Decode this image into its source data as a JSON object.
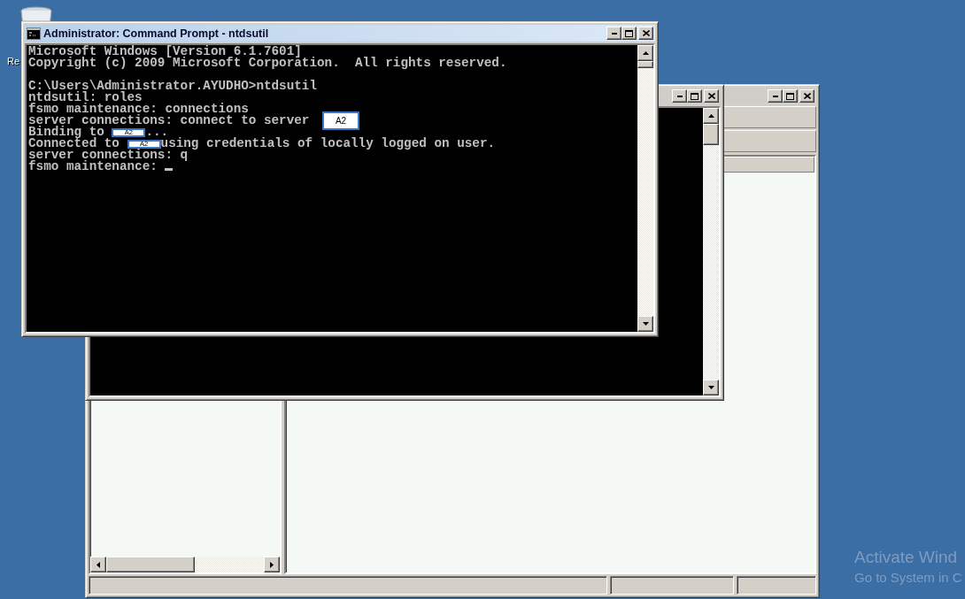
{
  "desktop": {
    "icons": [
      {
        "label": "Re"
      }
    ],
    "activation_notice": {
      "title": "Activate Wind",
      "subtitle": "Go to System in C"
    }
  },
  "windows": [
    {
      "kind": "mmc",
      "active": false
    },
    {
      "kind": "console",
      "active": false
    },
    {
      "kind": "console",
      "active": true,
      "title": "Administrator: Command Prompt - ntdsutil",
      "lines": [
        {
          "blank_before": false,
          "segments": [
            {
              "kind": "text",
              "text": "Microsoft Windows [Version 6.1.7601]"
            }
          ]
        },
        {
          "blank_before": false,
          "segments": [
            {
              "kind": "text",
              "text": "Copyright (c) 2009 Microsoft Corporation.  All rights reserved."
            }
          ]
        },
        {
          "blank_before": true,
          "segments": [
            {
              "kind": "text",
              "text": "C:\\Users\\Administrator.AYUDHO>ntdsutil"
            }
          ]
        },
        {
          "blank_before": false,
          "segments": [
            {
              "kind": "text",
              "text": "ntdsutil: roles"
            }
          ]
        },
        {
          "blank_before": false,
          "segments": [
            {
              "kind": "text",
              "text": "fsmo maintenance: connections"
            }
          ]
        },
        {
          "blank_before": false,
          "segments": [
            {
              "kind": "text",
              "text": "server connections: connect to server "
            },
            {
              "kind": "redaction-large",
              "text": "A2"
            }
          ]
        },
        {
          "blank_before": false,
          "segments": [
            {
              "kind": "text",
              "text": "Binding to "
            },
            {
              "kind": "redaction",
              "text": "A2"
            },
            {
              "kind": "text",
              "text": "..."
            }
          ]
        },
        {
          "blank_before": false,
          "segments": [
            {
              "kind": "text",
              "text": "Connected to "
            },
            {
              "kind": "redaction",
              "text": "A2"
            },
            {
              "kind": "text",
              "text": "using credentials of locally logged on user."
            }
          ]
        },
        {
          "blank_before": false,
          "segments": [
            {
              "kind": "text",
              "text": "server connections: q"
            }
          ]
        },
        {
          "blank_before": false,
          "segments": [
            {
              "kind": "text",
              "text": "fsmo maintenance: "
            },
            {
              "kind": "cursor"
            }
          ]
        }
      ]
    }
  ]
}
